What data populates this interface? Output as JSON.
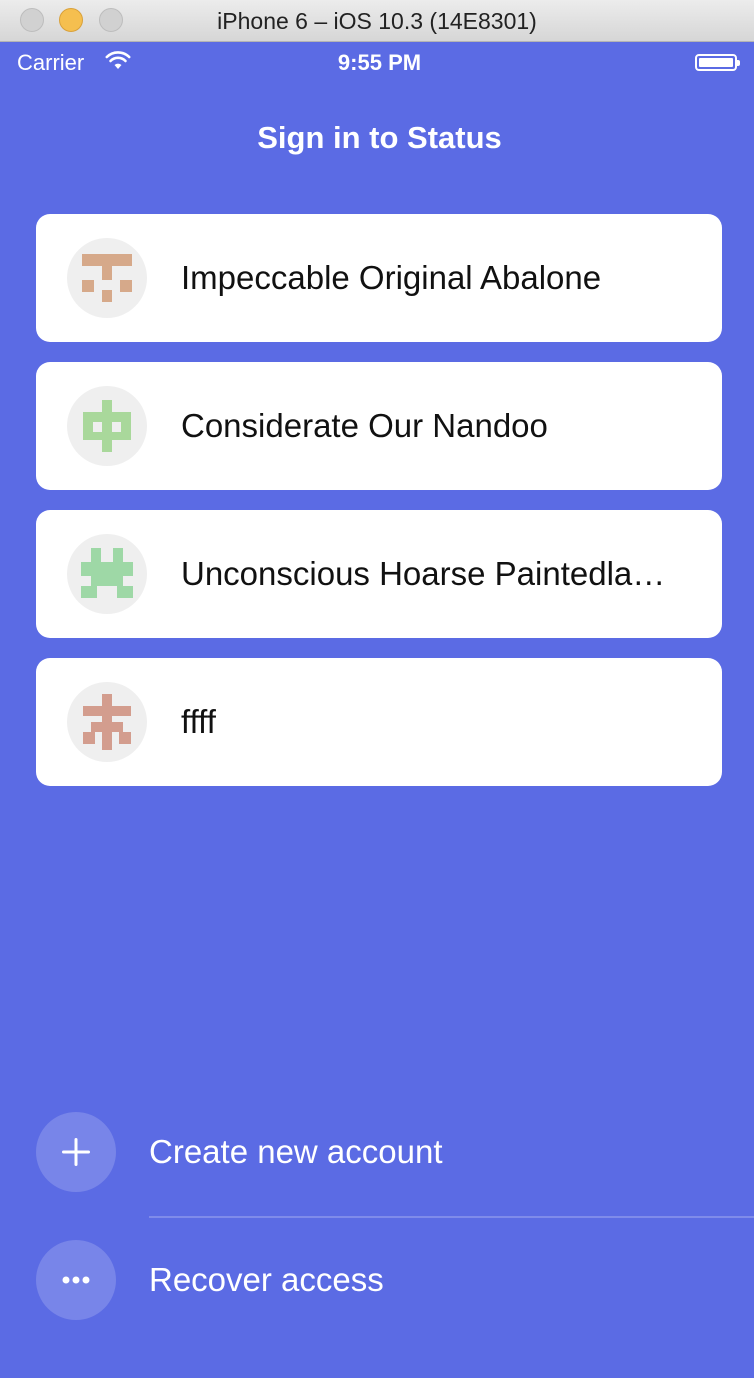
{
  "window": {
    "title": "iPhone 6 – iOS 10.3 (14E8301)"
  },
  "status_bar": {
    "carrier": "Carrier",
    "time": "9:55 PM",
    "wifi_icon": "wifi-icon",
    "battery_icon": "battery-icon"
  },
  "screen": {
    "title": "Sign in to Status"
  },
  "accounts": [
    {
      "name": "Impeccable Original Abalone",
      "avatar_color": "#d6a98a",
      "avatar_icon": "identicon"
    },
    {
      "name": "Considerate Our Nandoo",
      "avatar_color": "#a9d89b",
      "avatar_icon": "identicon"
    },
    {
      "name": "Unconscious Hoarse Paintedla…",
      "avatar_color": "#9ed8a6",
      "avatar_icon": "identicon"
    },
    {
      "name": "ffff",
      "avatar_color": "#d39d8e",
      "avatar_icon": "identicon"
    }
  ],
  "actions": {
    "create": {
      "label": "Create new account",
      "icon": "plus-icon"
    },
    "recover": {
      "label": "Recover access",
      "icon": "ellipsis-icon"
    }
  },
  "colors": {
    "background": "#5b6be4",
    "card": "#ffffff"
  }
}
